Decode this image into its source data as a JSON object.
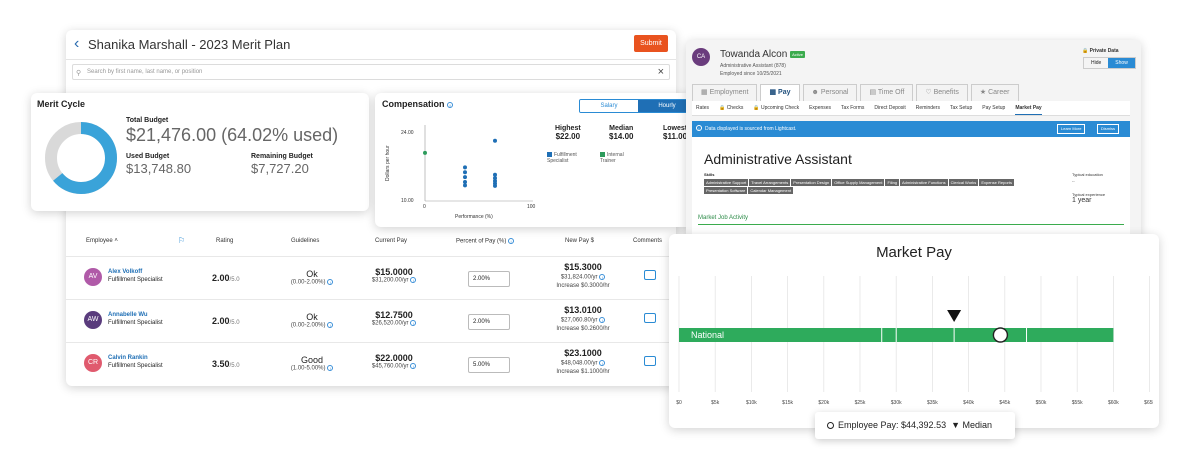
{
  "merit_plan": {
    "title": "Shanika Marshall - 2023 Merit Plan",
    "submit_label": "Submit",
    "search_placeholder": "Search by first name, last name, or position"
  },
  "merit_cycle": {
    "title": "Merit Cycle",
    "total_budget_label": "Total Budget",
    "total_budget_value": "$21,476.00 (64.02% used)",
    "used_budget_label": "Used Budget",
    "used_budget_value": "$13,748.80",
    "remaining_budget_label": "Remaining Budget",
    "remaining_budget_value": "$7,727.20",
    "used_fraction": 0.6402,
    "colors": {
      "used": "#3aa3d9",
      "remaining": "#d9d9d9"
    }
  },
  "compensation": {
    "title": "Compensation",
    "toggle": [
      "Salary",
      "Hourly"
    ],
    "toggle_selected": "Hourly",
    "stats": [
      {
        "label": "Highest",
        "value": "$22.00"
      },
      {
        "label": "Median",
        "value": "$14.00"
      },
      {
        "label": "Lowest",
        "value": "$11.00"
      }
    ],
    "legend": [
      {
        "name": "Fulfillment Specialist",
        "color": "#1f6fb5"
      },
      {
        "name": "Internal Trainer",
        "color": "#2d9b5c"
      }
    ]
  },
  "chart_data": {
    "type": "scatter",
    "xlabel": "Performance (%)",
    "ylabel": "Dollars per hour",
    "x_ticks": [
      "0",
      "100"
    ],
    "y_ticks": [
      "24.00",
      "10.00"
    ],
    "xlim": [
      0,
      100
    ],
    "ylim": [
      10,
      24
    ],
    "series": [
      {
        "name": "Fulfillment Specialist",
        "color": "#1f6fb5",
        "points": [
          [
            40,
            16.5
          ],
          [
            40,
            15.5
          ],
          [
            40,
            14.5
          ],
          [
            40,
            13.5
          ],
          [
            40,
            12.8
          ],
          [
            70,
            22
          ],
          [
            70,
            15
          ],
          [
            70,
            14.3
          ],
          [
            70,
            13.7
          ],
          [
            70,
            13.2
          ],
          [
            70,
            12.7
          ]
        ]
      },
      {
        "name": "Internal Trainer",
        "color": "#2d9b5c",
        "points": [
          [
            0,
            19.5
          ]
        ]
      }
    ]
  },
  "table": {
    "headers": [
      "Employee",
      "Rating",
      "Guidelines",
      "Current Pay",
      "Percent of Pay (%)",
      "New Pay $",
      "Comments"
    ],
    "rows": [
      {
        "initials": "AV",
        "avatar_color": "#b05aa8",
        "name": "Alex Volkoff",
        "job": "Fulfillment Specialist",
        "rating": "2.00",
        "rating_of": "/5.0",
        "guideline": "Ok",
        "guideline_range": "(0.00-2.00%)",
        "current_pay": "$15.0000",
        "current_annual": "$31,200.00/yr",
        "percent": "2.00%",
        "new_pay": "$15.3000",
        "new_annual": "$31,824.00/yr",
        "increase": "Increase $0.3000/hr"
      },
      {
        "initials": "AW",
        "avatar_color": "#5a3c7d",
        "name": "Annabelle Wu",
        "job": "Fulfillment Specialist",
        "rating": "2.00",
        "rating_of": "/5.0",
        "guideline": "Ok",
        "guideline_range": "(0.00-2.00%)",
        "current_pay": "$12.7500",
        "current_annual": "$26,520.00/yr",
        "percent": "2.00%",
        "new_pay": "$13.0100",
        "new_annual": "$27,060.80/yr",
        "increase": "Increase $0.2600/hr"
      },
      {
        "initials": "CR",
        "avatar_color": "#e05a6e",
        "name": "Calvin Rankin",
        "job": "Fulfillment Specialist",
        "rating": "3.50",
        "rating_of": "/5.0",
        "guideline": "Good",
        "guideline_range": "(1.00-5.00%)",
        "current_pay": "$22.0000",
        "current_annual": "$45,760.00/yr",
        "percent": "5.00%",
        "new_pay": "$23.1000",
        "new_annual": "$48,048.00/yr",
        "increase": "Increase $1.1000/hr"
      }
    ]
  },
  "profile": {
    "initials": "CA",
    "name": "Towanda Alcon",
    "status": "Active",
    "position": "Administrative Assistant (878)",
    "employed_since": "Employed since 10/25/2021",
    "private_label": "Private Data",
    "hide_label": "Hide",
    "show_label": "Show",
    "tabs": [
      "Employment",
      "Pay",
      "Personal",
      "Time Off",
      "Benefits",
      "Career"
    ],
    "active_tab": "Pay",
    "subtabs": [
      "Rates",
      "Checks",
      "Upcoming Check",
      "Expenses",
      "Tax Forms",
      "Direct Deposit",
      "Reminders",
      "Tax Setup",
      "Pay Setup",
      "Market Pay"
    ],
    "active_subtab": "Market Pay",
    "banner_text": "Data displayed is sourced from Lightcast.",
    "learn_more": "Learn More",
    "dismiss": "Dismiss",
    "job_title": "Administrative Assistant",
    "skills_label": "Skills",
    "skills": [
      "Administrative Support",
      "Travel Arrangements",
      "Presentation Design",
      "Office Supply Management",
      "Filing",
      "Administrative Functions",
      "Clerical Works",
      "Expense Reports",
      "Presentation Software",
      "Calendar Management"
    ],
    "education_label": "Typical education",
    "education_value": "--",
    "experience_label": "Typical experience",
    "experience_value": "1 year",
    "market_activity": "Market Job Activity"
  },
  "market_pay": {
    "title": "Market Pay",
    "bar_label": "National",
    "bar_color": "#2eab5c",
    "axis_ticks": [
      "$0",
      "$5k",
      "$10k",
      "$15k",
      "$20k",
      "$25k",
      "$30k",
      "$35k",
      "$40k",
      "$45k",
      "$50k",
      "$55k",
      "$60k",
      "$65k"
    ],
    "range_min": 0,
    "range_max": 60000,
    "employee_pay": 44392.53,
    "median": 38000,
    "employee_pay_label": "Employee Pay: $44,392.53",
    "median_label": "Median"
  }
}
